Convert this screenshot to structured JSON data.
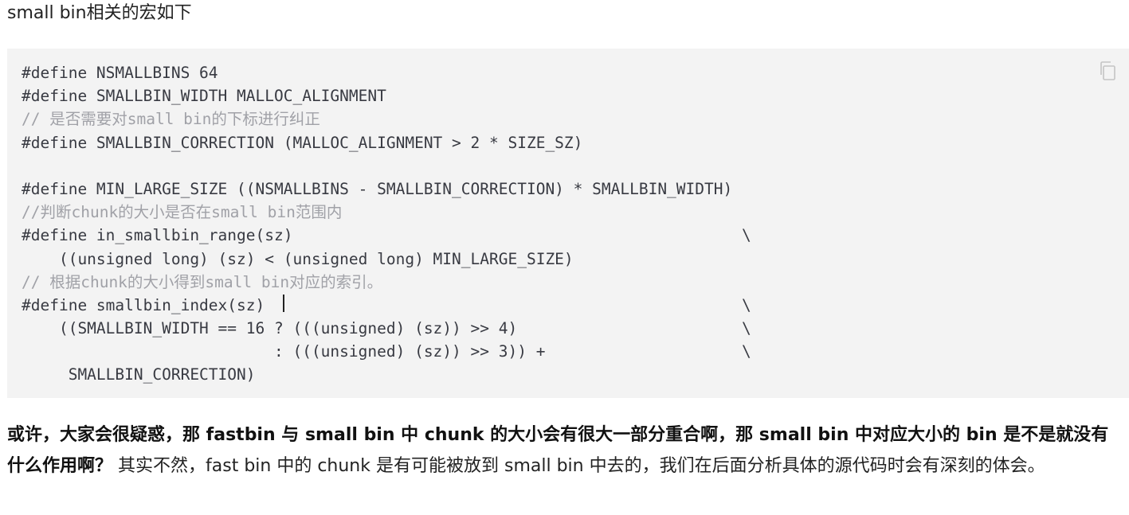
{
  "intro": {
    "text": "small bin相关的宏如下"
  },
  "code": {
    "lines": [
      {
        "text": "#define NSMALLBINS 64",
        "kind": "code"
      },
      {
        "text": "#define SMALLBIN_WIDTH MALLOC_ALIGNMENT",
        "kind": "code"
      },
      {
        "text": "// 是否需要对small bin的下标进行纠正",
        "kind": "comment"
      },
      {
        "text": "#define SMALLBIN_CORRECTION (MALLOC_ALIGNMENT > 2 * SIZE_SZ)",
        "kind": "code"
      },
      {
        "text": "",
        "kind": "code"
      },
      {
        "text": "#define MIN_LARGE_SIZE ((NSMALLBINS - SMALLBIN_CORRECTION) * SMALLBIN_WIDTH)",
        "kind": "code"
      },
      {
        "text": "//判断chunk的大小是否在small bin范围内",
        "kind": "comment"
      },
      {
        "text": "#define in_smallbin_range(sz)                                                \\",
        "kind": "code"
      },
      {
        "text": "    ((unsigned long) (sz) < (unsigned long) MIN_LARGE_SIZE)",
        "kind": "code"
      },
      {
        "text": "// 根据chunk的大小得到small bin对应的索引。",
        "kind": "comment"
      },
      {
        "text": "#define smallbin_index(sz)                                                   \\",
        "kind": "code"
      },
      {
        "text": "    ((SMALLBIN_WIDTH == 16 ? (((unsigned) (sz)) >> 4)                        \\",
        "kind": "code"
      },
      {
        "text": "                           : (((unsigned) (sz)) >> 3)) +                     \\",
        "kind": "code"
      },
      {
        "text": "     SMALLBIN_CORRECTION)",
        "kind": "code"
      }
    ],
    "copy_icon": "copy-icon"
  },
  "paragraph": {
    "bold_text": "或许，大家会很疑惑，那 fastbin 与 small bin 中 chunk 的大小会有很大一部分重合啊，那 small bin 中对应大小的 bin 是不是就没有什么作用啊？",
    "normal_text": " 其实不然，fast bin 中的 chunk 是有可能被放到 small bin 中去的，我们在后面分析具体的源代码时会有深刻的体会。"
  }
}
